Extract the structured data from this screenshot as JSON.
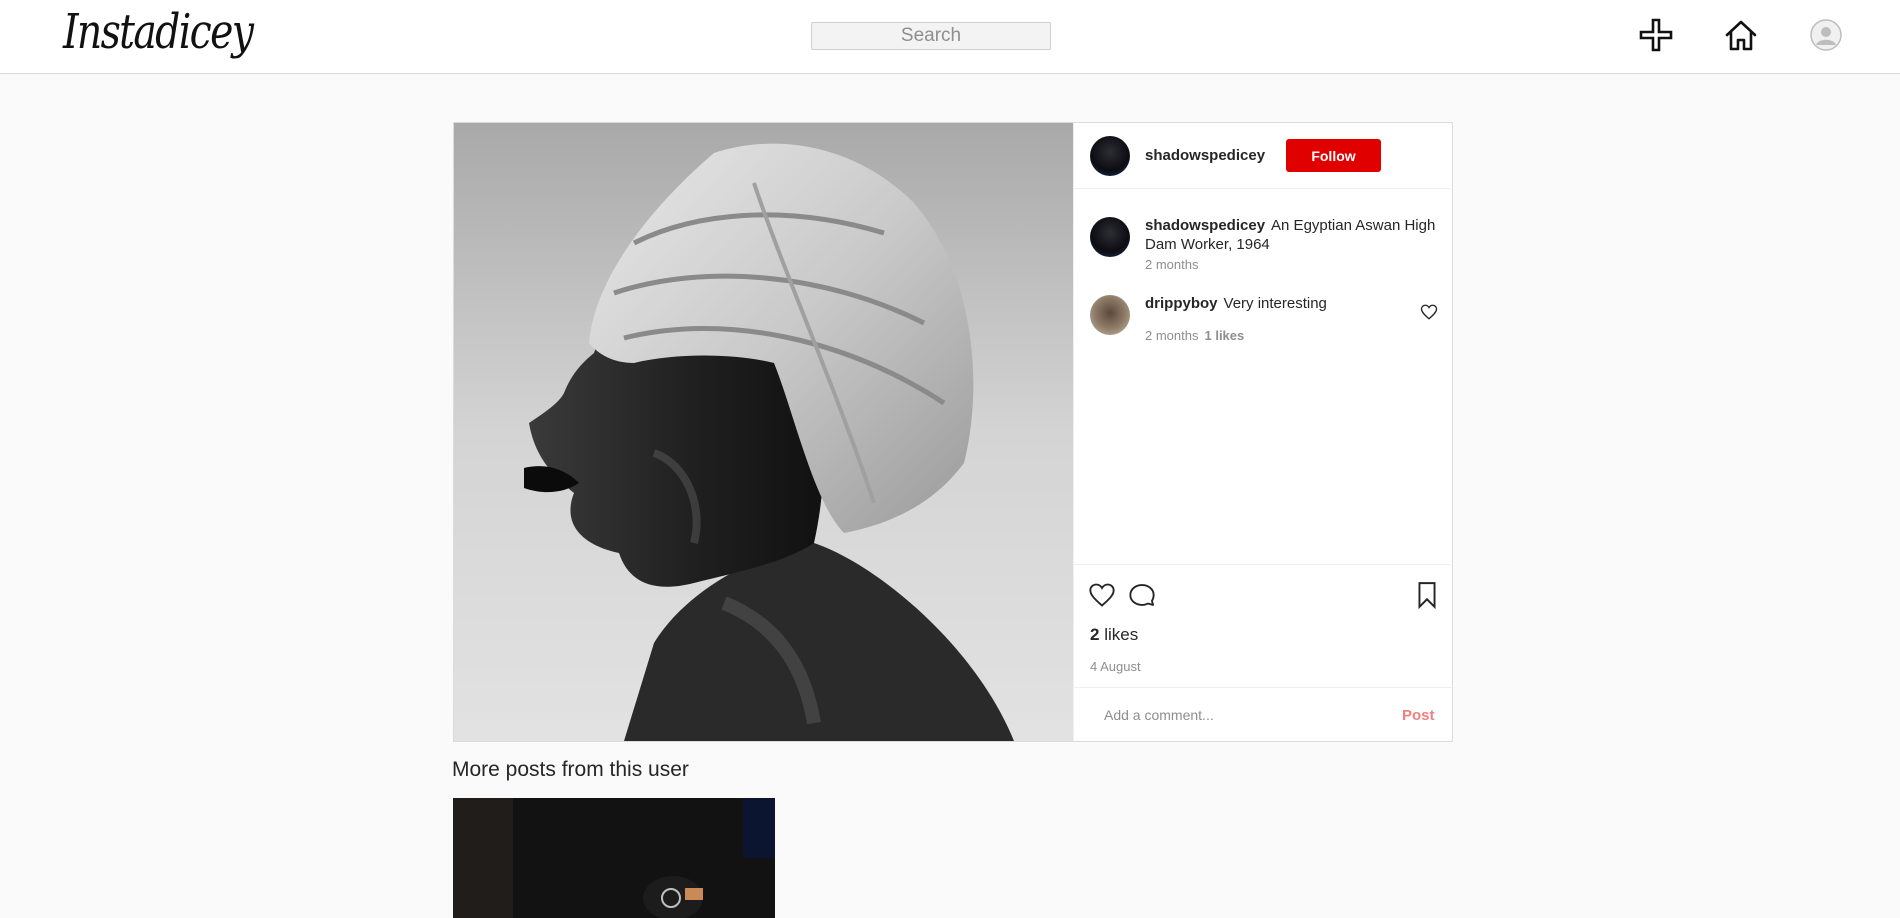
{
  "header": {
    "logo_text": "Instadicey",
    "search_placeholder": "Search",
    "icons": [
      "plus-icon",
      "home-icon",
      "profile-avatar-icon"
    ]
  },
  "post": {
    "author": "shadowspedicey",
    "follow_label": "Follow",
    "caption": {
      "user": "shadowspedicey",
      "text": "An Egyptian Aswan High Dam Worker, 1964",
      "time": "2 months"
    },
    "comments": [
      {
        "user": "drippyboy",
        "text": "Very interesting",
        "time": "2 months",
        "likes": "1 likes"
      }
    ],
    "likes_count": "2",
    "likes_label": "likes",
    "date": "4 August",
    "comment_placeholder": "Add a comment...",
    "post_label": "Post"
  },
  "more_posts": {
    "title": "More posts from this user"
  },
  "colors": {
    "follow_button": "#e00000",
    "post_button": "#f08080",
    "border": "#dbdbdb",
    "background": "#fafafa"
  }
}
